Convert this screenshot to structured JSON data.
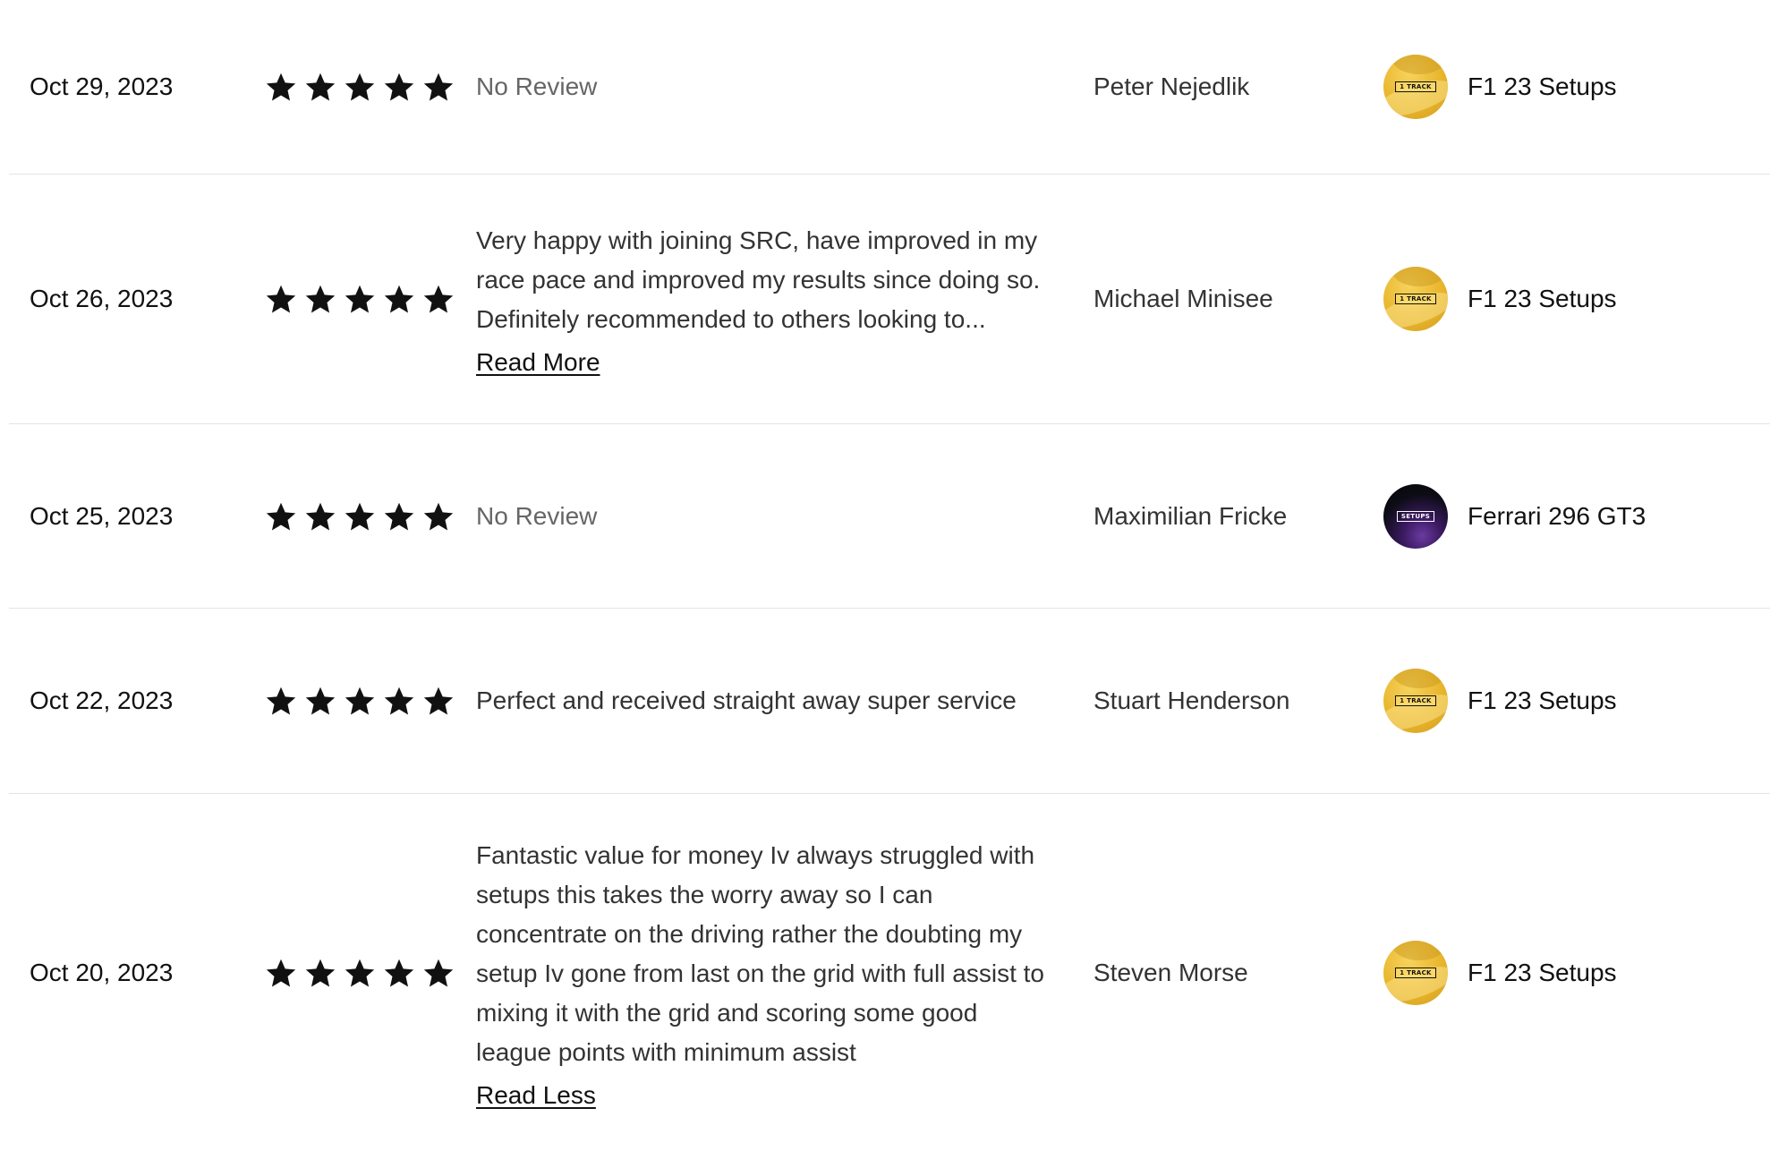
{
  "reviews": [
    {
      "date": "Oct 29, 2023",
      "rating": 5,
      "review": "No Review",
      "has_review": false,
      "link": "",
      "reviewer": "Peter Nejedlik",
      "product": "F1 23 Setups",
      "product_badge": "1 TRACK",
      "product_style": "gold"
    },
    {
      "date": "Oct 26, 2023",
      "rating": 5,
      "review": "Very happy with joining SRC, have improved in my race pace and improved my results since doing so. Definitely recommended to others looking to...",
      "has_review": true,
      "link": "Read More",
      "reviewer": "Michael Minisee",
      "product": "F1 23 Setups",
      "product_badge": "1 TRACK",
      "product_style": "gold"
    },
    {
      "date": "Oct 25, 2023",
      "rating": 5,
      "review": "No Review",
      "has_review": false,
      "link": "",
      "reviewer": "Maximilian Fricke",
      "product": "Ferrari 296 GT3",
      "product_badge": "SETUPS",
      "product_style": "dark"
    },
    {
      "date": "Oct 22, 2023",
      "rating": 5,
      "review": "Perfect and received straight away super service",
      "has_review": true,
      "link": "",
      "reviewer": "Stuart Henderson",
      "product": "F1 23 Setups",
      "product_badge": "1 TRACK",
      "product_style": "gold"
    },
    {
      "date": "Oct 20, 2023",
      "rating": 5,
      "review": "Fantastic value for money Iv always struggled with setups this takes the worry away so I can concentrate on the driving rather the doubting my setup Iv gone from last on the grid with full assist to mixing it with the grid and scoring some good league points with minimum assist",
      "has_review": true,
      "link": "Read Less",
      "reviewer": "Steven Morse",
      "product": "F1 23 Setups",
      "product_badge": "1 TRACK",
      "product_style": "gold"
    }
  ]
}
